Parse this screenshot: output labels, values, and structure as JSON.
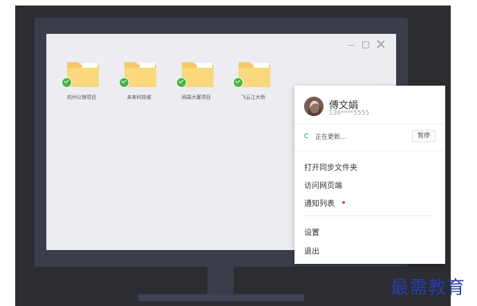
{
  "folders": [
    {
      "label": "杭州公馆项目"
    },
    {
      "label": "未来科技城"
    },
    {
      "label": "网易大厦项目"
    },
    {
      "label": "飞云江大桥"
    }
  ],
  "folder_color": "#f9d87e",
  "sync_ok_color": "#4cb24c",
  "account": {
    "name": "傅文娟",
    "phone": "136****5555"
  },
  "sync": {
    "status": "正在更新...",
    "pause_label": "暂停"
  },
  "menu": {
    "open_sync_folder": "打开同步文件夹",
    "visit_web": "访问网页端",
    "notifications": "通知列表",
    "settings": "设置",
    "quit": "退出"
  },
  "watermark": "最需教育"
}
